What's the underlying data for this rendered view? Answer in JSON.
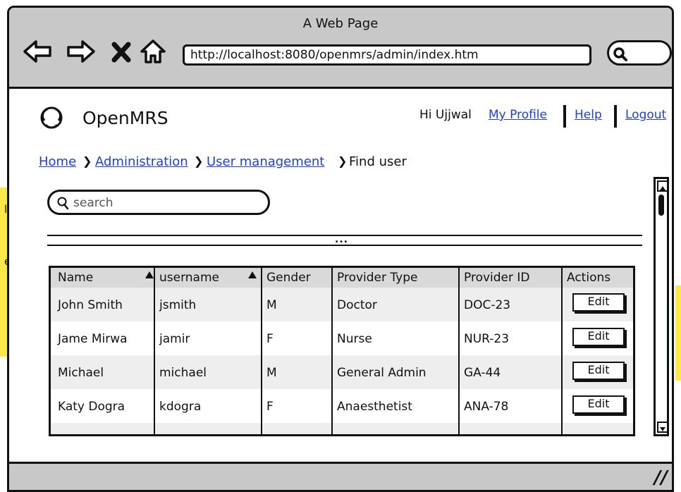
{
  "window": {
    "title": "A Web Page",
    "url": "http://localhost:8080/openmrs/admin/index.htm"
  },
  "sticky_left": {
    "line1": "ll",
    "line2": "er"
  },
  "app": {
    "brand": "OpenMRS",
    "greeting": "Hi Ujjwal",
    "links": {
      "profile": "My Profile",
      "help": "Help",
      "logout": "Logout"
    }
  },
  "breadcrumb": {
    "home": "Home",
    "administration": "Administration",
    "user_management": "User management",
    "current": "Find user"
  },
  "search": {
    "placeholder": "search",
    "value": ""
  },
  "divider": {
    "dots": "..."
  },
  "table": {
    "columns": [
      "Name",
      "username",
      "Gender",
      "Provider Type",
      "Provider ID",
      "Actions"
    ],
    "rows": [
      {
        "name": "John Smith",
        "username": "jsmith",
        "gender": "M",
        "provider_type": "Doctor",
        "provider_id": "DOC-23",
        "action": "Edit"
      },
      {
        "name": "Jame Mirwa",
        "username": "jamir",
        "gender": "F",
        "provider_type": "Nurse",
        "provider_id": "NUR-23",
        "action": "Edit"
      },
      {
        "name": "Michael",
        "username": "michael",
        "gender": "M",
        "provider_type": "General Admin",
        "provider_id": "GA-44",
        "action": "Edit"
      },
      {
        "name": "Katy Dogra",
        "username": "kdogra",
        "gender": "F",
        "provider_type": "Anaesthetist",
        "provider_id": "ANA-78",
        "action": "Edit"
      }
    ]
  },
  "icons": {
    "back": "back-arrow-icon",
    "forward": "forward-arrow-icon",
    "stop": "close-icon",
    "home": "home-icon",
    "search": "search-icon",
    "logo": "openmrs-logo-icon"
  },
  "colors": {
    "link": "#1d3fd8",
    "chrome": "#c8c8c8",
    "sticky": "#fde84a",
    "header_row": "#d9d9d9",
    "alt_row": "#eeeeee"
  }
}
